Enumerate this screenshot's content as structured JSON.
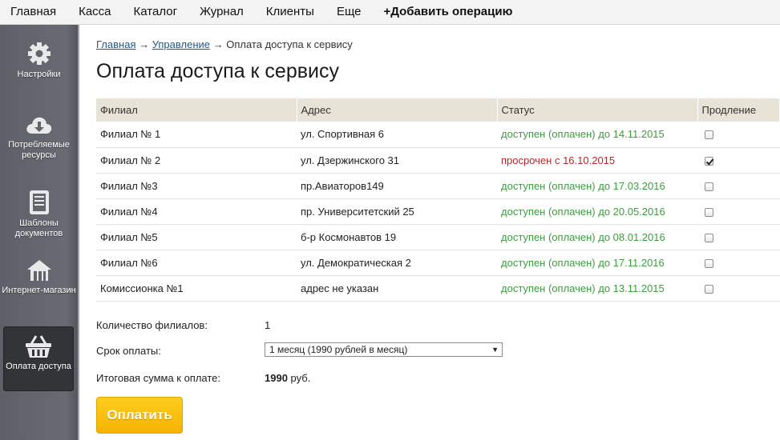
{
  "topnav": {
    "items": [
      "Главная",
      "Касса",
      "Каталог",
      "Журнал",
      "Клиенты",
      "Еще"
    ],
    "add_operation": "+Добавить операцию"
  },
  "sidebar": {
    "items": [
      {
        "label": "Настройки",
        "icon": "gear-icon"
      },
      {
        "label": "Потребляемые ресурсы",
        "icon": "cloud-download-icon"
      },
      {
        "label": "Шаблоны документов",
        "icon": "document-icon"
      },
      {
        "label": "Интернет-магазин",
        "icon": "house-icon"
      },
      {
        "label": "Оплата доступа",
        "icon": "basket-icon",
        "active": true
      }
    ]
  },
  "breadcrumb": {
    "home": "Главная",
    "sep1": " → ",
    "management": "Управление",
    "sep2": " → ",
    "current": "Оплата доступа к сервису"
  },
  "page_title": "Оплата доступа к сервису",
  "table": {
    "headers": [
      "Филиал",
      "Адрес",
      "Статус",
      "Продление"
    ],
    "rows": [
      {
        "branch": "Филиал № 1",
        "address": "ул. Спортивная 6",
        "status": "доступен (оплачен) до 14.11.2015",
        "status_type": "ok",
        "renew": false
      },
      {
        "branch": "Филиал № 2",
        "address": "ул. Дзержинского 31",
        "status": "просрочен с 16.10.2015",
        "status_type": "bad",
        "renew": true
      },
      {
        "branch": "Филиал №3",
        "address": "пр.Авиаторов149",
        "status": "доступен (оплачен) до 17.03.2016",
        "status_type": "ok",
        "renew": false
      },
      {
        "branch": "Филиал №4",
        "address": "пр. Университетский 25",
        "status": "доступен (оплачен) до 20.05.2016",
        "status_type": "ok",
        "renew": false
      },
      {
        "branch": "Филиал №5",
        "address": "б-р Космонавтов 19",
        "status": "доступен (оплачен) до 08.01.2016",
        "status_type": "ok",
        "renew": false
      },
      {
        "branch": "Филиал №6",
        "address": "ул. Демократическая 2",
        "status": "доступен (оплачен) до 17.11.2016",
        "status_type": "ok",
        "renew": false
      },
      {
        "branch": "Комиссионка №1",
        "address": "адрес не указан",
        "status": "доступен (оплачен) до 13.11.2015",
        "status_type": "ok",
        "renew": false
      }
    ]
  },
  "summary": {
    "count_label": "Количество филиалов:",
    "count_value": "1",
    "term_label": "Срок оплаты:",
    "term_value": "1 месяц (1990 рублей в месяц)",
    "total_label": "Итоговая сумма к оплате:",
    "total_amount": "1990",
    "total_currency": " руб."
  },
  "pay_button": "Оплатить",
  "colors": {
    "status_ok": "#3f9b3f",
    "status_bad": "#b02b2b",
    "pay_button": "#f5b400",
    "table_header": "#e8e3d7",
    "sidebar": "#5d6068"
  }
}
